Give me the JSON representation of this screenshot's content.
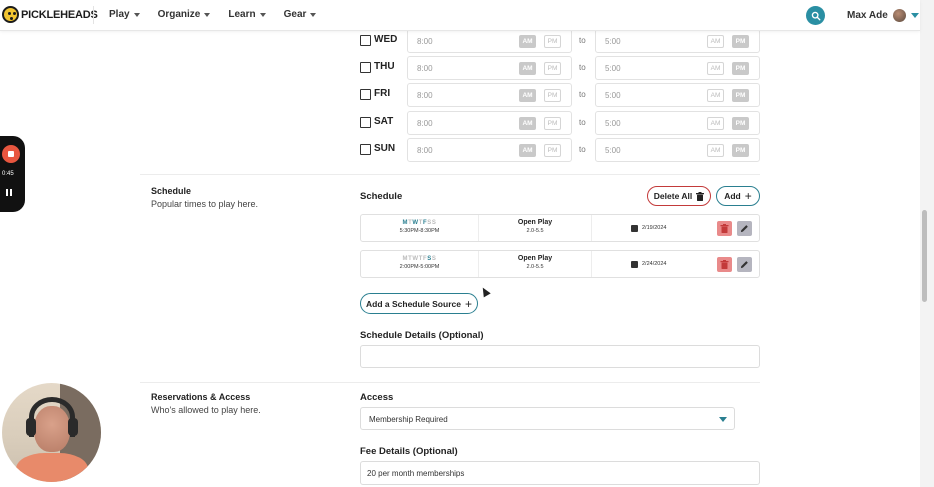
{
  "header": {
    "logo_text": "PICKLEHEADS",
    "nav": [
      {
        "label": "Play"
      },
      {
        "label": "Organize"
      },
      {
        "label": "Learn"
      },
      {
        "label": "Gear"
      }
    ],
    "user_name": "Max Ade"
  },
  "hours": {
    "to_label": "to",
    "am": "AM",
    "pm": "PM",
    "rows": [
      {
        "day": "WED",
        "open": "8:00",
        "close": "5:00"
      },
      {
        "day": "THU",
        "open": "8:00",
        "close": "5:00"
      },
      {
        "day": "FRI",
        "open": "8:00",
        "close": "5:00"
      },
      {
        "day": "SAT",
        "open": "8:00",
        "close": "5:00"
      },
      {
        "day": "SUN",
        "open": "8:00",
        "close": "5:00"
      }
    ]
  },
  "schedule_section": {
    "title": "Schedule",
    "subtitle": "Popular times to play here.",
    "heading": "Schedule",
    "delete_all_label": "Delete All",
    "add_label": "Add",
    "entries": [
      {
        "days": [
          "M",
          "T",
          "W",
          "T",
          "F",
          "S",
          "S"
        ],
        "active": [
          true,
          false,
          true,
          false,
          true,
          false,
          false
        ],
        "times": "5:30PM-8:30PM",
        "play_type": "Open Play",
        "range": "2.0-5.5",
        "date": "2/19/2024"
      },
      {
        "days": [
          "M",
          "T",
          "W",
          "T",
          "F",
          "S",
          "S"
        ],
        "active": [
          false,
          false,
          false,
          false,
          false,
          true,
          false
        ],
        "times": "2:00PM-5:00PM",
        "play_type": "Open Play",
        "range": "2.0-5.5",
        "date": "2/24/2024"
      }
    ],
    "add_source_label": "Add a Schedule Source",
    "details_label": "Schedule Details (Optional)",
    "details_value": ""
  },
  "access_section": {
    "title": "Reservations & Access",
    "subtitle": "Who's allowed to play here.",
    "access_label": "Access",
    "access_value": "Membership Required",
    "fee_label": "Fee Details (Optional)",
    "fee_value": "20 per month memberships"
  },
  "recorder": {
    "time": "0:45"
  },
  "colors": {
    "accent": "#2a8fa3",
    "danger": "#c33a3a"
  }
}
